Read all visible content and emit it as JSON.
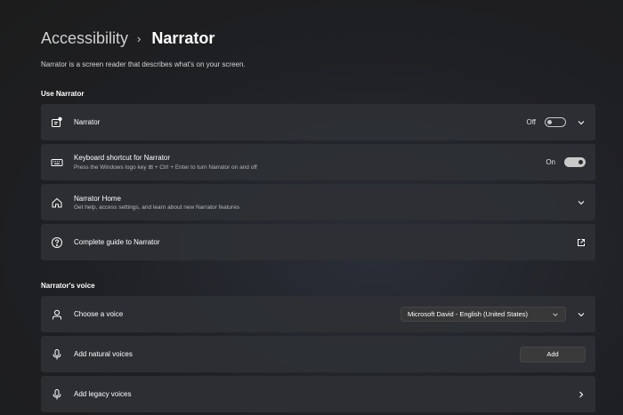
{
  "breadcrumb": {
    "parent": "Accessibility",
    "separator": "›",
    "current": "Narrator"
  },
  "description": "Narrator is a screen reader that describes what's on your screen.",
  "sections": {
    "use_narrator": {
      "heading": "Use Narrator",
      "narrator": {
        "title": "Narrator",
        "icon": "narrator-icon",
        "toggle_label": "Off",
        "toggle_state": false
      },
      "keyboard_shortcut": {
        "title": "Keyboard shortcut for Narrator",
        "subtitle": "Press the Windows logo key ⊞ + Ctrl + Enter to turn Narrator on and off",
        "icon": "keyboard-icon",
        "toggle_label": "On",
        "toggle_state": true
      },
      "narrator_home": {
        "title": "Narrator Home",
        "subtitle": "Get help, access settings, and learn about new Narrator features",
        "icon": "home-icon"
      },
      "guide": {
        "title": "Complete guide to Narrator",
        "icon": "help-icon"
      }
    },
    "narrators_voice": {
      "heading": "Narrator's voice",
      "choose_voice": {
        "title": "Choose a voice",
        "icon": "person-icon",
        "selected": "Microsoft David - English (United States)"
      },
      "natural_voices": {
        "title": "Add natural voices",
        "icon": "microphone-icon",
        "button_label": "Add"
      },
      "legacy_voices": {
        "title": "Add legacy voices",
        "icon": "microphone-icon"
      }
    }
  },
  "colors": {
    "background": "#202020",
    "card": "#2e3034",
    "text": "#ffffff",
    "secondary_text": "#b8b8b8"
  }
}
